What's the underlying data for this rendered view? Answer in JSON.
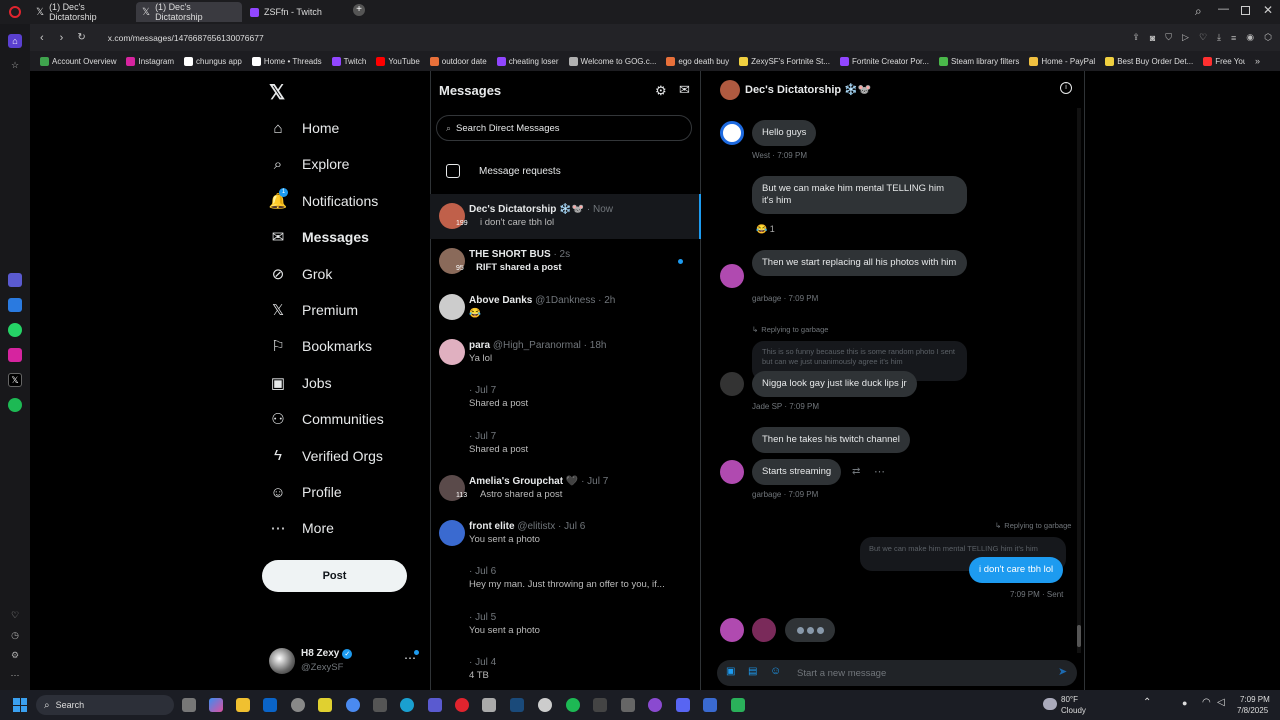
{
  "browser": {
    "tabs": [
      {
        "title": "(1) Dec's Dictatorship"
      },
      {
        "title": "(1) Dec's Dictatorship"
      },
      {
        "title": "ZSFfn - Twitch"
      }
    ],
    "url": "x.com/messages/1476687656130076677",
    "bookmarks": [
      {
        "label": "Account Overview",
        "color": "#3fa34d"
      },
      {
        "label": "Instagram",
        "color": "#d6249f"
      },
      {
        "label": "chungus app",
        "color": "#ffffff"
      },
      {
        "label": "Home • Threads",
        "color": "#ffffff"
      },
      {
        "label": "Twitch",
        "color": "#9146ff"
      },
      {
        "label": "YouTube",
        "color": "#ff0000"
      },
      {
        "label": "outdoor date",
        "color": "#e8703a"
      },
      {
        "label": "cheating loser",
        "color": "#9146ff"
      },
      {
        "label": "Welcome to GOG.c...",
        "color": "#b0b0b0"
      },
      {
        "label": "ego death buy",
        "color": "#e8703a"
      },
      {
        "label": "ZexySF's Fortnite St...",
        "color": "#f0d040"
      },
      {
        "label": "Fortnite Creator Por...",
        "color": "#9146ff"
      },
      {
        "label": "Steam library filters",
        "color": "#4ab84a"
      },
      {
        "label": "Home - PayPal",
        "color": "#f0c040"
      },
      {
        "label": "Best Buy Order Det...",
        "color": "#f0d040"
      },
      {
        "label": "Free YouTube Video...",
        "color": "#ff3030"
      }
    ]
  },
  "nav": {
    "items": [
      {
        "label": "Home",
        "icon": "home-icon",
        "glyph": "⌂"
      },
      {
        "label": "Explore",
        "icon": "search-icon",
        "glyph": "⌕"
      },
      {
        "label": "Notifications",
        "icon": "bell-icon",
        "glyph": "🔔",
        "badge": "1"
      },
      {
        "label": "Messages",
        "icon": "mail-icon",
        "glyph": "✉"
      },
      {
        "label": "Grok",
        "icon": "grok-icon",
        "glyph": "⊘"
      },
      {
        "label": "Premium",
        "icon": "x-logo-icon",
        "glyph": "𝕏"
      },
      {
        "label": "Bookmarks",
        "icon": "bookmark-icon",
        "glyph": "⚐"
      },
      {
        "label": "Jobs",
        "icon": "briefcase-icon",
        "glyph": "▣"
      },
      {
        "label": "Communities",
        "icon": "people-icon",
        "glyph": "⚇"
      },
      {
        "label": "Verified Orgs",
        "icon": "lightning-icon",
        "glyph": "ϟ"
      },
      {
        "label": "Profile",
        "icon": "person-icon",
        "glyph": "☺"
      },
      {
        "label": "More",
        "icon": "more-circle-icon",
        "glyph": "⋯"
      }
    ],
    "post_label": "Post",
    "account": {
      "name": "H8 Zexy",
      "handle": "@ZexySF"
    }
  },
  "messages": {
    "title": "Messages",
    "search_placeholder": "Search Direct Messages",
    "requests_label": "Message requests",
    "conversations": [
      {
        "name": "Dec's Dictatorship ❄️🐭",
        "meta": " · Now",
        "preview": "i don't care tbh lol",
        "badge": "199",
        "color": "#c0604a"
      },
      {
        "name": "THE SHORT BUS",
        "meta": " · 2s",
        "preview": "RIFT shared a post",
        "badge": "95",
        "color": "#8a6a5a"
      },
      {
        "name": "Above Danks",
        "meta": " @1Dankness · 2h",
        "preview": "😂",
        "badge": "",
        "color": "#cccccc"
      },
      {
        "name": "para",
        "meta": " @High_Paranormal · 18h",
        "preview": "Ya lol",
        "badge": "",
        "color": "#e0b0c0"
      },
      {
        "name": "",
        "meta": " · Jul 7",
        "preview": "Shared a post",
        "badge": "",
        "color": ""
      },
      {
        "name": "",
        "meta": " · Jul 7",
        "preview": "Shared a post",
        "badge": "",
        "color": ""
      },
      {
        "name": "Amelia's Groupchat 🖤",
        "meta": " · Jul 7",
        "preview": "Astro shared a post",
        "badge": "113",
        "color": "#5a4a4a"
      },
      {
        "name": "front elite",
        "meta": " @elitistx · Jul 6",
        "preview": "You sent a photo",
        "badge": "",
        "color": "#3a6ad0"
      },
      {
        "name": "",
        "meta": " · Jul 6",
        "preview": "Hey my man. Just throwing an offer to you, if...",
        "badge": "",
        "color": ""
      },
      {
        "name": "",
        "meta": " · Jul 5",
        "preview": "You sent a photo",
        "badge": "",
        "color": ""
      },
      {
        "name": "",
        "meta": " · Jul 4",
        "preview": "4 TB",
        "badge": "",
        "color": ""
      }
    ]
  },
  "chat": {
    "title": "Dec's Dictatorship ❄️🐭",
    "messages": [
      {
        "text": "Hello guys"
      },
      {
        "text": "But we can make him mental TELLING him it's him"
      },
      {
        "text": "Then we start replacing all his photos with him"
      },
      {
        "text": "Nigga look gay just like duck lips jr"
      },
      {
        "text": "Then he takes his twitch channel"
      },
      {
        "text": "Starts streaming"
      },
      {
        "text": "i don't care tbh lol"
      }
    ],
    "metas": [
      "West · 7:09 PM",
      "garbage · 7:09 PM",
      "Jade SP · 7:09 PM",
      "garbage · 7:09 PM",
      "7:09 PM · Sent"
    ],
    "reply1_label": "Replying to garbage",
    "reply1_quote": "This is so funny because this is some random photo I sent but can we just unanimously agree it's him",
    "reply2_label": "Replying to garbage",
    "reply2_quote": "But we can make him mental TELLING him it's him",
    "reaction": "😂 1",
    "composer_placeholder": "Start a new message"
  },
  "taskbar": {
    "search_label": "Search",
    "weather_temp": "80°F",
    "weather_desc": "Cloudy",
    "time": "7:09 PM",
    "date": "7/8/2025"
  }
}
